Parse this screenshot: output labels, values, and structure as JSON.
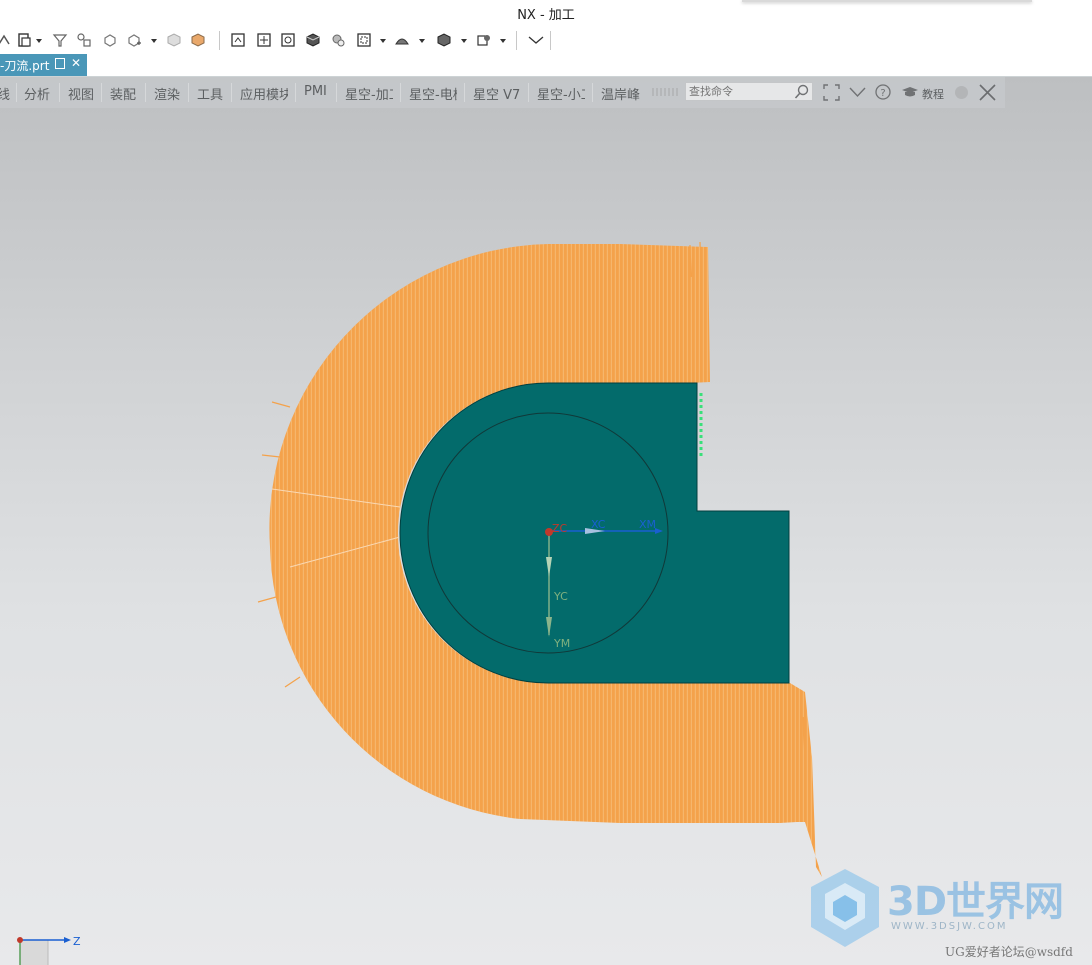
{
  "window": {
    "title": "NX - 加工"
  },
  "file_tab": {
    "name": "-刀流.prt",
    "close_glyph": "✕"
  },
  "quick_access": {
    "icons": [
      "snap-icon",
      "paste-icon",
      "select-filter-icon",
      "feature-icon",
      "hide-icon",
      "show-icon",
      "cube-gray-icon",
      "cube-orange-icon",
      "sketch-icon",
      "move-icon",
      "refresh-icon",
      "shaded-icon",
      "render-icon",
      "fit-icon",
      "view-orient-icon",
      "solid-icon",
      "layer-icon",
      "more-icon"
    ]
  },
  "ribbon": {
    "tabs": [
      "线",
      "分析",
      "视图",
      "装配",
      "渲染",
      "工具",
      "应用模块",
      "PMI",
      "星空-加工",
      "星空-电极",
      "星空 V7",
      "星空-小工具",
      "温岸峰"
    ],
    "search_placeholder": "查找命令",
    "tutorial_label": "教程"
  },
  "viewport": {
    "csys_labels": {
      "origin": "ZC",
      "xc": "XC",
      "xm": "XM",
      "yc": "YC",
      "ym": "YM"
    },
    "triad_axis_label": "Z",
    "colors": {
      "toolpath": "#f4a24b",
      "part": "#036b6b",
      "axis_x": "#1a5fd1",
      "axis_y": "#8bb48b",
      "origin": "#c0392b"
    }
  },
  "watermark": {
    "brand": "3D世界网",
    "url": "WWW.3DSJW.COM",
    "credit": "UG爱好者论坛@wsdfd"
  }
}
